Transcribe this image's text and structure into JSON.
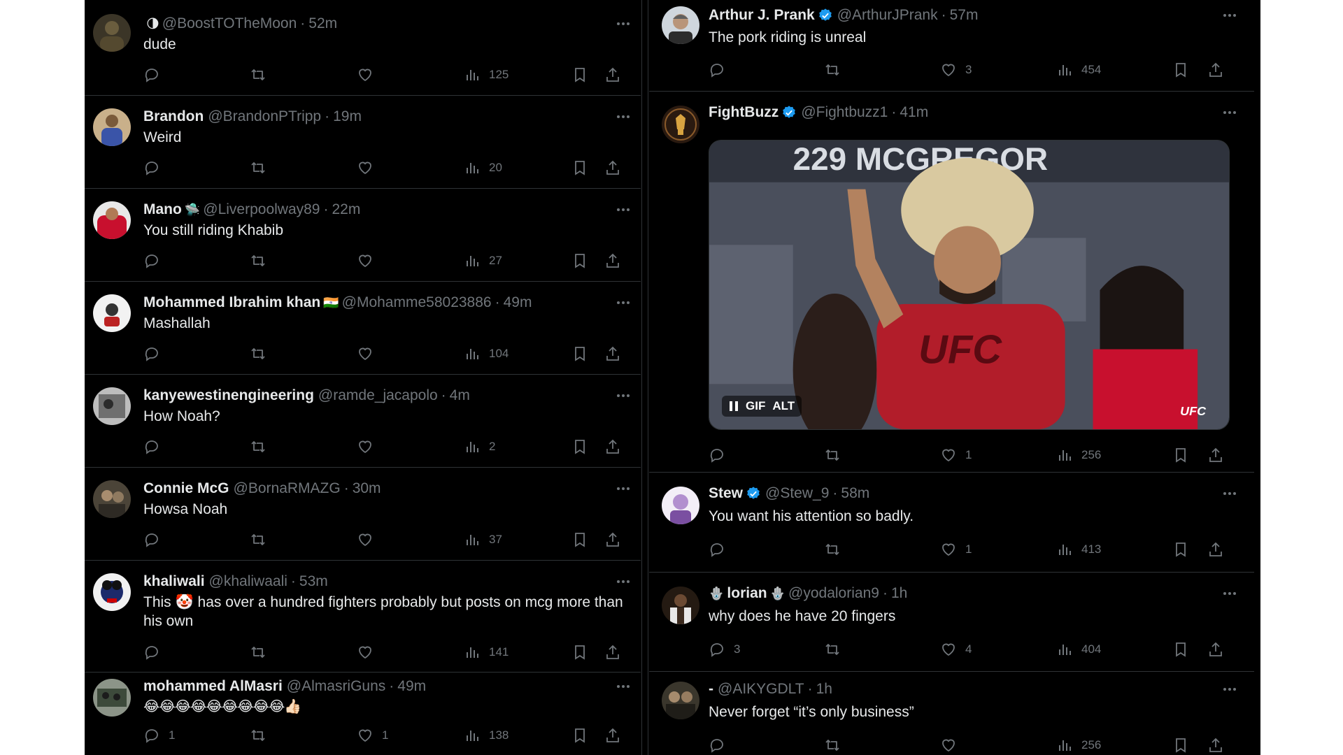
{
  "left_column": {
    "tweets": [
      {
        "name": "",
        "handle": "@BoostTOTheMoon",
        "time": "52m",
        "text": "dude",
        "replies": "",
        "likes": "",
        "views": "125",
        "avatar_color": "#6a5d3e"
      },
      {
        "name": "Brandon",
        "handle": "@BrandonPTripp",
        "time": "19m",
        "text": "Weird",
        "replies": "",
        "likes": "",
        "views": "20",
        "avatar_color": "#3a54a8"
      },
      {
        "name": "Mano",
        "handle": "@Liverpoolway89",
        "time": "22m",
        "text": "You still riding Khabib",
        "replies": "",
        "likes": "",
        "views": "27",
        "avatar_color": "#c8102e"
      },
      {
        "name": "Mohammed Ibrahim khan",
        "handle": "@Mohamme58023886",
        "time": "49m",
        "text": "Mashallah",
        "replies": "",
        "likes": "",
        "views": "104",
        "avatar_color": "#f2f2f2"
      },
      {
        "name": "kanyewestinengineering",
        "handle": "@ramde_jacapolo",
        "time": "4m",
        "text": "How Noah?",
        "replies": "",
        "likes": "",
        "views": "2",
        "avatar_color": "#8a8a8a"
      },
      {
        "name": "Connie McG",
        "handle": "@BornaRMAZG",
        "time": "30m",
        "text": "Howsa Noah",
        "replies": "",
        "likes": "",
        "views": "37",
        "avatar_color": "#7c6f5e"
      },
      {
        "name": "khaliwali",
        "handle": "@khaliwaali",
        "time": "53m",
        "text_before": "This",
        "text_emoji": "🤡",
        "text_after": "has over a hundred fighters probably but posts on mcg more than his own",
        "replies": "",
        "likes": "",
        "views": "141",
        "avatar_color": "#1c2a6b"
      },
      {
        "name": "mohammed AlMasri",
        "handle": "@AlmasriGuns",
        "time": "49m",
        "text": "😂😂😂😂😂😂😂😂😂👍🏻",
        "replies": "1",
        "likes": "1",
        "views": "138",
        "avatar_color": "#5c6b5a"
      }
    ]
  },
  "right_column": {
    "tweets": [
      {
        "name": "Arthur J. Prank",
        "handle": "@ArthurJPrank",
        "time": "57m",
        "text": "The pork riding is unreal",
        "verified": true,
        "replies": "",
        "likes": "3",
        "views": "454",
        "avatar_color": "#9aa3ad"
      },
      {
        "name": "FightBuzz",
        "handle": "@Fightbuzz1",
        "time": "41m",
        "text": "",
        "verified": true,
        "replies": "",
        "likes": "1",
        "views": "256",
        "avatar_color": "#2a1a10",
        "media": {
          "type": "GIF",
          "gif_label": "GIF",
          "alt_label": "ALT",
          "scene_text_top": "229  MCGREGOR",
          "scene_shirt": "UFC",
          "scene_corner": "UFC"
        }
      },
      {
        "name": "Stew",
        "handle": "@Stew_9",
        "time": "58m",
        "text": "You want his attention so badly.",
        "verified": true,
        "replies": "",
        "likes": "1",
        "views": "413",
        "avatar_color": "#d9c3e8"
      },
      {
        "name": "lorian",
        "handle": "@yodalorian9",
        "time": "1h",
        "text": "why does he have 20 fingers",
        "verified": false,
        "replies": "3",
        "likes": "4",
        "views": "404",
        "avatar_color": "#3b2a1e"
      },
      {
        "name": "-",
        "handle": "@AIKYGDLT",
        "time": "1h",
        "text": "Never forget “it’s only business”",
        "verified": false,
        "replies": "",
        "likes": "",
        "views": "256",
        "avatar_color": "#4a4437"
      }
    ]
  },
  "theme": {
    "background": "#000000",
    "text": "#e7e9ea",
    "muted": "#71767b",
    "border": "#2f3336",
    "verified": "#1d9bf0"
  },
  "icons": [
    "reply-icon",
    "retweet-icon",
    "like-icon",
    "views-icon",
    "bookmark-icon",
    "share-icon",
    "more-icon",
    "verified-icon"
  ],
  "inline_emojis": {
    "tweet_l0_prefix": "🌗",
    "tweet_l2_suffix": "🛸",
    "tweet_l3_flag": "🇮🇳",
    "tweet_r3_prefix": "🪬",
    "tweet_r3_suffix": "🪬"
  }
}
